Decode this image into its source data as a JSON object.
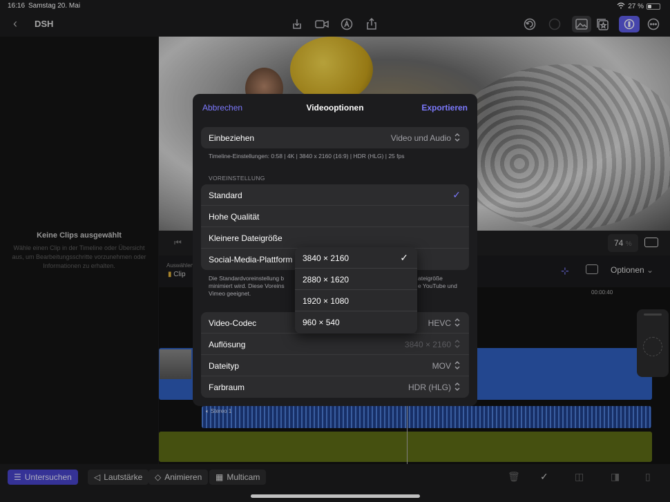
{
  "status": {
    "time": "16:16",
    "date": "Samstag 20. Mai",
    "battery": "27 %"
  },
  "toolbar": {
    "title": "DSH"
  },
  "inspector": {
    "heading": "Keine Clips ausgewählt",
    "text": "Wähle einen Clip in der Timeline oder Übersicht aus, um Bearbeitungsschritte vorzunehmen oder Informationen zu erhalten."
  },
  "viewer": {
    "zoom": "74",
    "zoom_unit": "%"
  },
  "timeline": {
    "select_label": "Auswählen",
    "clip_label": "Clip",
    "options_label": "Optionen",
    "ruler_time": "00:00:40",
    "audio_label": "Stereo 1"
  },
  "modal": {
    "cancel": "Abbrechen",
    "title": "Videooptionen",
    "export": "Exportieren",
    "include_label": "Einbeziehen",
    "include_value": "Video und Audio",
    "timeline_info": "Timeline-Einstellungen: 0:58 | 4K | 3840 x 2160 (16:9) | HDR (HLG) | 25 fps",
    "preset_section": "VOREINSTELLUNG",
    "presets": [
      "Standard",
      "Hohe Qualität",
      "Kleinere Dateigröße",
      "Social-Media-Plattform"
    ],
    "description_left": "Die Standardvoreinstellung b",
    "description_right": "ateigröße",
    "description_line2_left": "minimiert wird. Diese Voreins",
    "description_line2_right": "e YouTube und",
    "description_line3": "Vimeo geeignet.",
    "codec_label": "Video-Codec",
    "codec_value": "HEVC",
    "resolution_label": "Auflösung",
    "resolution_value": "3840 × 2160",
    "filetype_label": "Dateityp",
    "filetype_value": "MOV",
    "colorspace_label": "Farbraum",
    "colorspace_value": "HDR (HLG)"
  },
  "resolution_menu": {
    "options": [
      "3840 × 2160",
      "2880 × 1620",
      "1920 × 1080",
      "960 × 540"
    ],
    "selected": "3840 × 2160"
  },
  "bottom": {
    "inspect": "Untersuchen",
    "volume": "Lautstärke",
    "animate": "Animieren",
    "multicam": "Multicam"
  },
  "colors": {
    "accent": "#7d7aff",
    "active_bg": "#5e5ce6"
  }
}
